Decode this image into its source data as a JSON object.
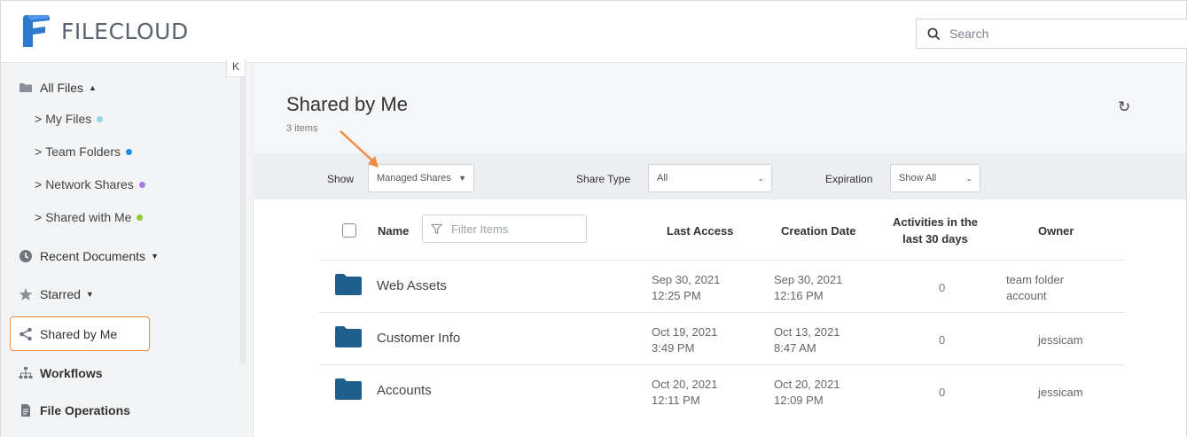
{
  "app": {
    "name": "FILECLOUD"
  },
  "search": {
    "placeholder": "Search"
  },
  "sidebar": {
    "collapse_label": "K",
    "all_files": "All Files",
    "sub_items": [
      {
        "label": "My Files",
        "dot_color": "#8fd9e0"
      },
      {
        "label": "Team Folders",
        "dot_color": "#1e8de0"
      },
      {
        "label": "Network Shares",
        "dot_color": "#a77be0"
      },
      {
        "label": "Shared with Me",
        "dot_color": "#8ccf2e"
      }
    ],
    "recent_documents": "Recent Documents",
    "starred": "Starred",
    "shared_by_me": "Shared by Me",
    "workflows": "Workflows",
    "file_operations": "File Operations"
  },
  "main": {
    "title": "Shared by Me",
    "count": "3 items",
    "filters": {
      "show_label": "Show",
      "show_value": "Managed Shares",
      "share_type_label": "Share Type",
      "share_type_value": "All",
      "expiration_label": "Expiration",
      "expiration_value": "Show All"
    },
    "table": {
      "headers": {
        "name": "Name",
        "last_access": "Last Access",
        "creation_date": "Creation Date",
        "activities_line1": "Activities in the",
        "activities_line2": "last 30 days",
        "owner": "Owner"
      },
      "filter_placeholder": "Filter Items",
      "rows": [
        {
          "name": "Web Assets",
          "last_access_date": "Sep 30, 2021",
          "last_access_time": "12:25 PM",
          "created_date": "Sep 30, 2021",
          "created_time": "12:16 PM",
          "activities": "0",
          "owner_line1": "team folder",
          "owner_line2": "account"
        },
        {
          "name": "Customer Info",
          "last_access_date": "Oct 19, 2021",
          "last_access_time": "3:49 PM",
          "created_date": "Oct 13, 2021",
          "created_time": "8:47 AM",
          "activities": "0",
          "owner_line1": "jessicam",
          "owner_line2": ""
        },
        {
          "name": "Accounts",
          "last_access_date": "Oct 20, 2021",
          "last_access_time": "12:11 PM",
          "created_date": "Oct 20, 2021",
          "created_time": "12:09 PM",
          "activities": "0",
          "owner_line1": "jessicam",
          "owner_line2": ""
        }
      ]
    }
  },
  "colors": {
    "accent_orange": "#f08a43",
    "folder_blue": "#1f5f8c",
    "logo_blue": "#2f7ad1"
  }
}
